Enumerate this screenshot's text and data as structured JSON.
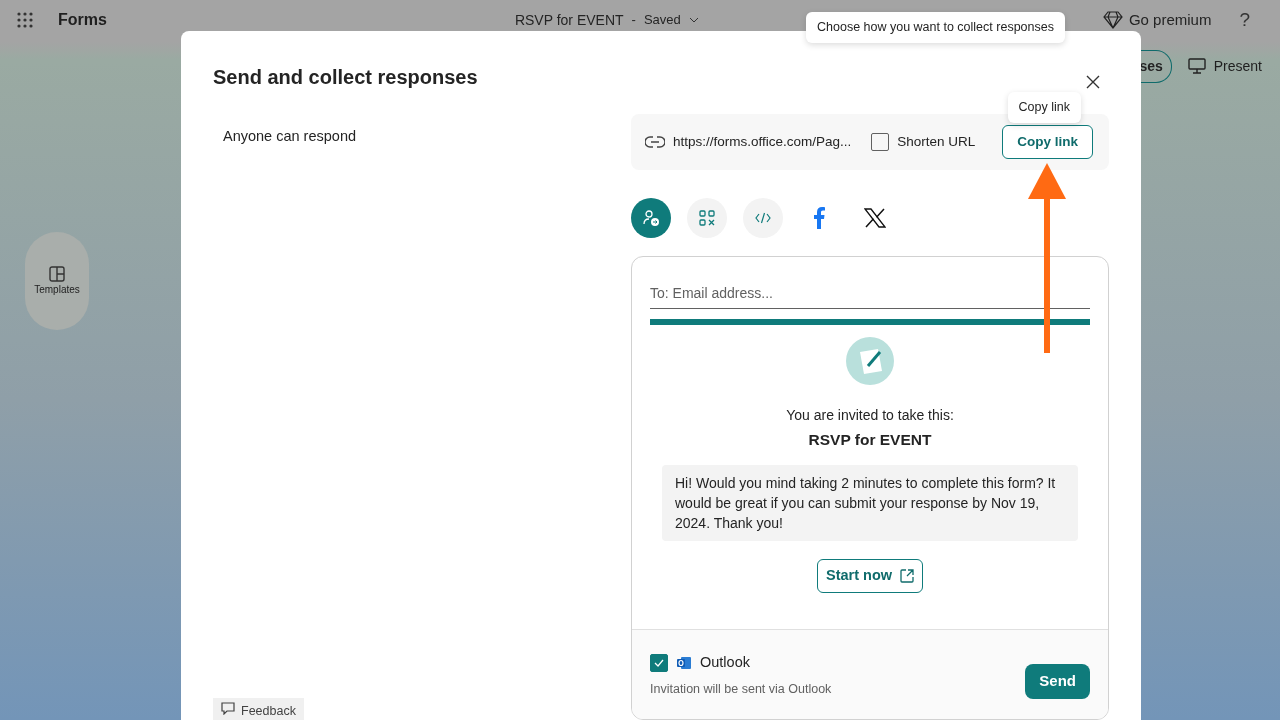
{
  "app_bar": {
    "app_name": "Forms",
    "document_title": "RSVP for EVENT",
    "separator": "-",
    "save_status": "Saved",
    "premium_label": "Go premium",
    "help_label": "?"
  },
  "top_tooltip": "Choose how you want to collect responses",
  "background_toolbar": {
    "responses_fragment": "ses",
    "present_label": "Present"
  },
  "sidebar": {
    "items": [
      {
        "label": "Templates"
      }
    ]
  },
  "dialog": {
    "title": "Send and collect responses",
    "audience": "Anyone can respond",
    "link": {
      "url": "https://forms.office.com/Pag...",
      "shorten_url": {
        "label": "Shorten URL",
        "checked": false
      },
      "copy_button": "Copy link",
      "tooltip": "Copy link"
    },
    "share_options": [
      {
        "kind": "email",
        "selected": true
      },
      {
        "kind": "qr",
        "selected": false
      },
      {
        "kind": "embed",
        "selected": false
      },
      {
        "kind": "facebook",
        "selected": false
      },
      {
        "kind": "x",
        "selected": false
      }
    ],
    "email": {
      "placeholder": "To: Email address...",
      "invite_line": "You are invited to take this:",
      "form_title": "RSVP for EVENT",
      "message": "Hi! Would you mind taking 2 minutes to complete this form? It would be great if you can submit your response by Nov 19, 2024. Thank you!",
      "start_button": "Start now",
      "outlook": {
        "label": "Outlook",
        "checked": true
      },
      "note": "Invitation will be sent via Outlook",
      "send_button": "Send"
    },
    "feedback_label": "Feedback"
  }
}
